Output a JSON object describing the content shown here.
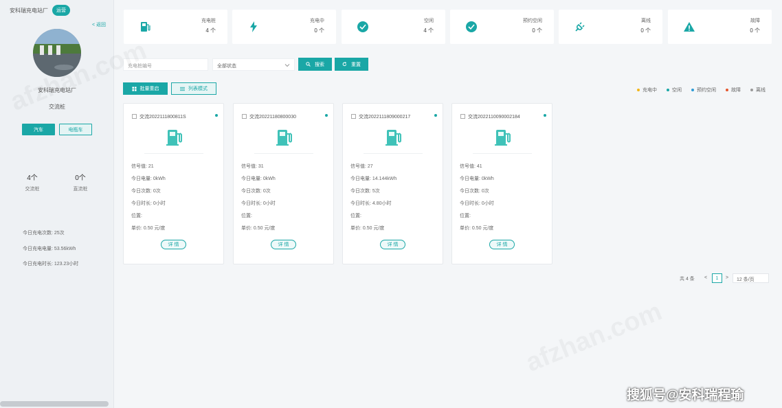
{
  "sidebar": {
    "site_name": "安科瑞充电站厂",
    "tag": "运营",
    "back": "< 返回",
    "name": "安科瑞充电站厂",
    "subtitle": "交流桩",
    "btn_car": "汽车",
    "btn_bike": "电瓶车",
    "stats": [
      {
        "value": "4个",
        "label": "交流桩"
      },
      {
        "value": "0个",
        "label": "直流桩"
      }
    ],
    "info": [
      "今日充电次数: 25次",
      "今日充电电量: 53.56kWh",
      "今日充电时长: 123.23小时"
    ]
  },
  "status_cards": [
    {
      "icon": "charger-icon",
      "label": "充电桩",
      "value": "4 个"
    },
    {
      "icon": "bolt-icon",
      "label": "充电中",
      "value": "0 个"
    },
    {
      "icon": "check-circle-icon",
      "label": "空闲",
      "value": "4 个"
    },
    {
      "icon": "check-circle-icon",
      "label": "预约空闲",
      "value": "0 个"
    },
    {
      "icon": "plug-icon",
      "label": "离线",
      "value": "0 个"
    },
    {
      "icon": "warning-icon",
      "label": "故障",
      "value": "0 个"
    }
  ],
  "search": {
    "placeholder": "充电桩编号",
    "status_value": "全部状态",
    "search_label": "搜索",
    "reset_label": "重置"
  },
  "actions": {
    "batch_label": "批量重启",
    "list_label": "列表模式"
  },
  "legend": [
    {
      "label": "充电中",
      "color": "#f2b61b"
    },
    {
      "label": "空闲",
      "color": "#1aa7a6"
    },
    {
      "label": "预约空闲",
      "color": "#2d9bd6"
    },
    {
      "label": "故障",
      "color": "#e4572e"
    },
    {
      "label": "离线",
      "color": "#999999"
    }
  ],
  "devices": [
    {
      "code": "交流2022111800811S",
      "rows": [
        "信号值: 21",
        "今日电量: 0kWh",
        "今日次数: 0次",
        "今日时长: 0小时",
        "位置:",
        "单价: 0.50 元/度"
      ],
      "detail": "详 情"
    },
    {
      "code": "交流20221180800030",
      "rows": [
        "信号值: 31",
        "今日电量: 0kWh",
        "今日次数: 0次",
        "今日时长: 0小时",
        "位置:",
        "单价: 0.50 元/度"
      ],
      "detail": "详 情"
    },
    {
      "code": "交流2022111809000217",
      "rows": [
        "信号值: 27",
        "今日电量: 14.144kWh",
        "今日次数: 5次",
        "今日时长: 4.80小时",
        "位置:",
        "单价: 0.50 元/度"
      ],
      "detail": "详 情"
    },
    {
      "code": "交流2022110090002184",
      "rows": [
        "信号值: 41",
        "今日电量: 0kWh",
        "今日次数: 0次",
        "今日时长: 0小时",
        "位置:",
        "单价: 0.50 元/度"
      ],
      "detail": "详 情"
    }
  ],
  "pagination": {
    "total": "共 4 条",
    "prev": "<",
    "page": "1",
    "next": ">",
    "size": "12 条/页"
  },
  "footer_watermark": "搜狐号@安科瑞程瑜"
}
